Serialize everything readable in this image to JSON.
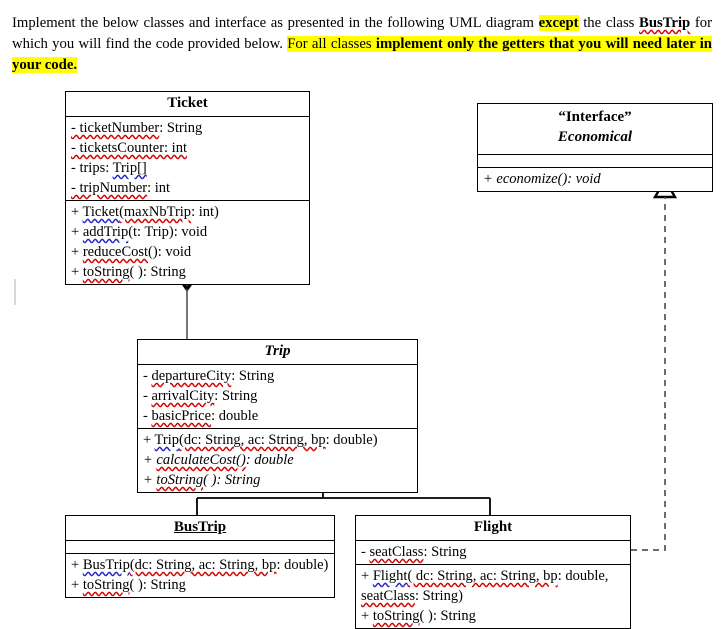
{
  "instructions": {
    "segments": [
      {
        "text": "Implement the below classes and interface as presented in the following UML diagram ",
        "style": "plain"
      },
      {
        "text": "except",
        "style": "bold-highlight"
      },
      {
        "text": " the class ",
        "style": "plain"
      },
      {
        "text": "BusTrip",
        "style": "bold-spell"
      },
      {
        "text": " for which you will find the code provided below. ",
        "style": "plain"
      },
      {
        "text": "For all classes ",
        "style": "highlight"
      },
      {
        "text": "implement only the getters that you will need later in your code.",
        "style": "bold-highlight"
      }
    ],
    "full_text": "Implement the below classes and interface as presented in the following UML diagram except the class BusTrip for which you will find the code provided below. For all classes implement only the getters that you will need later in your code.",
    "highlight_color": "#ffff00",
    "text_color": "#000000"
  },
  "diagram": {
    "type": "uml-class-diagram",
    "classes": [
      {
        "id": "ticket",
        "name": "Ticket",
        "abstract": false,
        "attributes": [
          "- ticketNumber: String",
          "- ticketsCounter: int",
          "- trips: Trip[]",
          "- tripNumber: int"
        ],
        "methods": [
          "+ Ticket(maxNbTrip: int)",
          "+ addTrip(t: Trip): void",
          "+ reduceCost(): void",
          "+ toString( ): String"
        ]
      },
      {
        "id": "trip",
        "name": "Trip",
        "abstract": true,
        "attributes": [
          "- departureCity: String",
          "- arrivalCity: String",
          "- basicPrice: double"
        ],
        "methods": [
          "+ Trip(dc: String, ac: String, bp: double)",
          "+ calculateCost(): double",
          "+ toString( ): String"
        ],
        "abstract_methods": [
          "calculateCost(): double",
          "toString( ): String"
        ]
      },
      {
        "id": "bustrip",
        "name": "BusTrip",
        "abstract": false,
        "attributes": [],
        "methods": [
          "+ BusTrip(dc: String, ac: String, bp: double)",
          "+ toString( ): String"
        ]
      },
      {
        "id": "flight",
        "name": "Flight",
        "abstract": false,
        "attributes": [
          "- seatClass: String"
        ],
        "methods": [
          "+ Flight( dc: String, ac: String, bp: double, seatClass: String)",
          "+ toString( ): String"
        ]
      }
    ],
    "interface": {
      "id": "economical",
      "stereotype": "“Interface”",
      "name": "Economical",
      "attributes": [],
      "methods": [
        "+ economize(): void"
      ]
    },
    "relationships": [
      {
        "kind": "aggregation",
        "from": "ticket",
        "to": "trip",
        "marker": "hollow-diamond"
      },
      {
        "kind": "generalization",
        "from": "bustrip",
        "to": "trip",
        "marker": "hollow-triangle"
      },
      {
        "kind": "generalization",
        "from": "flight",
        "to": "trip",
        "marker": "hollow-triangle"
      },
      {
        "kind": "realization",
        "from": "flight",
        "to": "economical",
        "marker": "hollow-triangle-dashed"
      }
    ]
  }
}
